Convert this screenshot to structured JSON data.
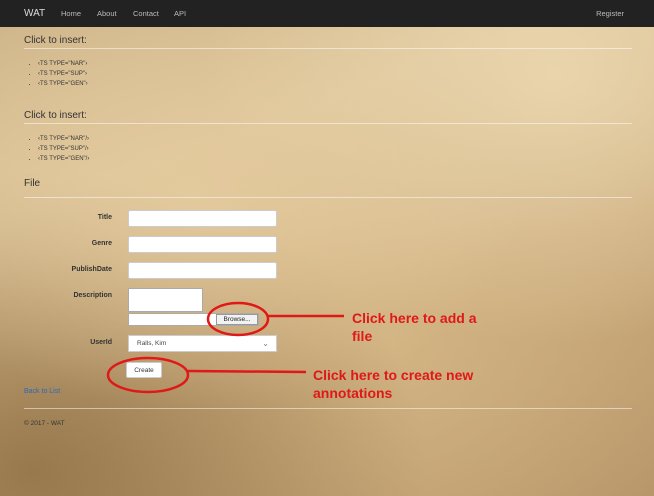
{
  "navbar": {
    "brand": "WAT",
    "items": [
      "Home",
      "About",
      "Contact",
      "API"
    ],
    "register": "Register"
  },
  "sections": [
    {
      "title": "Click to insert:",
      "items": [
        "‹TS TYPE=\"NAR\"›",
        "‹TS TYPE=\"SUP\"›",
        "‹TS TYPE=\"GEN\"›"
      ]
    },
    {
      "title": "Click to insert:",
      "items": [
        "‹TS TYPE=\"NAR\"/›",
        "‹TS TYPE=\"SUP\"/›",
        "‹TS TYPE=\"GEN\"/›"
      ]
    }
  ],
  "form": {
    "heading": "File",
    "labels": {
      "title": "Title",
      "genre": "Genre",
      "publish_date": "PublishDate",
      "description": "Description",
      "user_id": "UserId"
    },
    "values": {
      "title": "",
      "genre": "",
      "publish_date": ""
    },
    "browse_label": "Browse...",
    "user_selected": "Ralls, Kim",
    "create_label": "Create"
  },
  "back_link": "Back to List",
  "footer": "© 2017 - WAT",
  "annotations": {
    "file_line1": "Click here to add a",
    "file_line2": "file",
    "create_line1": "Click here to create new",
    "create_line2": "annotations",
    "color": "#e01818"
  },
  "icons": {
    "select_chevron": "chevron-down-icon"
  }
}
